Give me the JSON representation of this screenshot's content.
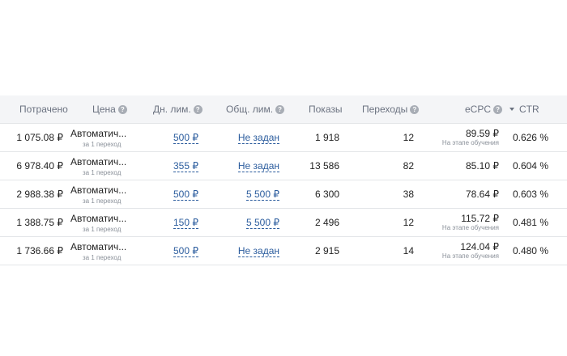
{
  "headers": {
    "spent": "Потрачено",
    "price": "Цена",
    "daily_limit": "Дн. лим.",
    "total_limit": "Общ. лим.",
    "impressions": "Показы",
    "clicks": "Переходы",
    "ecpc": "eCPC",
    "ctr": "CTR"
  },
  "help_icon_glyph": "?",
  "rows": [
    {
      "spent": "1 075.08 ₽",
      "strategy": "Автоматич...",
      "strategy_sub": "за 1 переход",
      "daily_limit": "500 ₽",
      "total_limit": "Не задан",
      "impressions": "1 918",
      "clicks": "12",
      "ecpc": "89.59 ₽",
      "ecpc_note": "На этапе обучения",
      "ctr": "0.626 %"
    },
    {
      "spent": "6 978.40 ₽",
      "strategy": "Автоматич...",
      "strategy_sub": "за 1 переход",
      "daily_limit": "355 ₽",
      "total_limit": "Не задан",
      "impressions": "13 586",
      "clicks": "82",
      "ecpc": "85.10 ₽",
      "ecpc_note": "",
      "ctr": "0.604 %"
    },
    {
      "spent": "2 988.38 ₽",
      "strategy": "Автоматич...",
      "strategy_sub": "за 1 переход",
      "daily_limit": "500 ₽",
      "total_limit": "5 500 ₽",
      "impressions": "6 300",
      "clicks": "38",
      "ecpc": "78.64 ₽",
      "ecpc_note": "",
      "ctr": "0.603 %"
    },
    {
      "spent": "1 388.75 ₽",
      "strategy": "Автоматич...",
      "strategy_sub": "за 1 переход",
      "daily_limit": "150 ₽",
      "total_limit": "5 500 ₽",
      "impressions": "2 496",
      "clicks": "12",
      "ecpc": "115.72 ₽",
      "ecpc_note": "На этапе обучения",
      "ctr": "0.481 %"
    },
    {
      "spent": "1 736.66 ₽",
      "strategy": "Автоматич...",
      "strategy_sub": "за 1 переход",
      "daily_limit": "500 ₽",
      "total_limit": "Не задан",
      "impressions": "2 915",
      "clicks": "14",
      "ecpc": "124.04 ₽",
      "ecpc_note": "На этапе обучения",
      "ctr": "0.480 %"
    }
  ],
  "colors": {
    "header_bg": "#f4f5f7",
    "link": "#2c5d9e",
    "muted": "#8a9099"
  }
}
